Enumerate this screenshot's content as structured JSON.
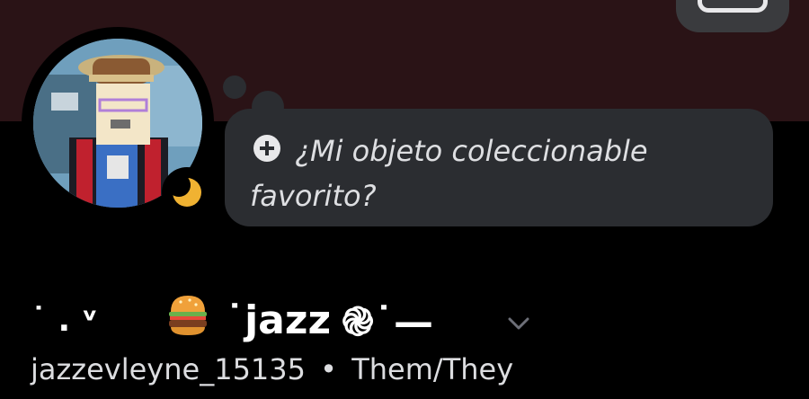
{
  "profile": {
    "custom_status": {
      "prompt": "¿Mi objeto coleccionable favorito?"
    },
    "display_name": {
      "prefix": "˙ . ᵛ",
      "name": "˙jazz",
      "suffix": "֎˙—"
    },
    "username": "jazzevleyne_15135",
    "separator": "•",
    "pronouns": "Them/They"
  },
  "icons": {
    "status": "crescent-moon-icon",
    "add": "plus-circle-icon",
    "expand": "chevron-down-icon",
    "emoji": "hamburger-emoji-icon"
  },
  "colors": {
    "banner": "#2a1316",
    "bubble": "#2b2d31",
    "status_idle": "#f0b232"
  }
}
